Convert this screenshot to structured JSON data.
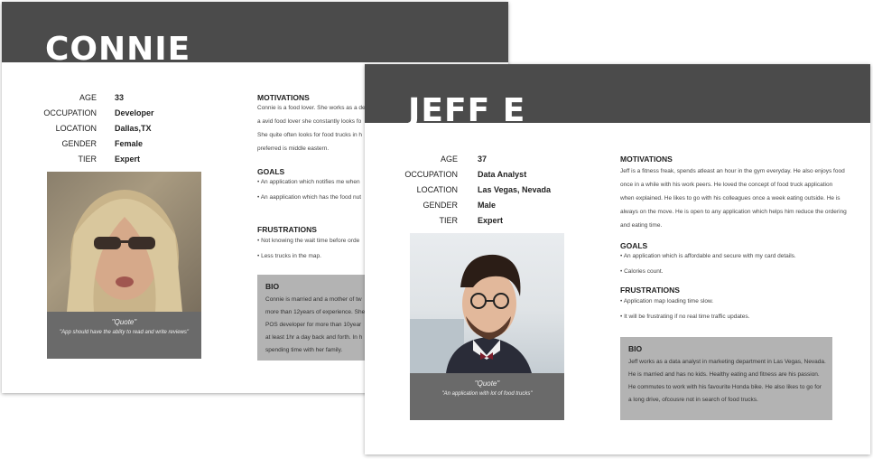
{
  "connie": {
    "name": "CONNIE",
    "facts": [
      {
        "key": "AGE",
        "value": "33"
      },
      {
        "key": "OCCUPATION",
        "value": "Developer"
      },
      {
        "key": "LOCATION",
        "value": "Dallas,TX"
      },
      {
        "key": "GENDER",
        "value": "Female"
      },
      {
        "key": "TIER",
        "value": "Expert"
      }
    ],
    "quote_title": "\"Quote\"",
    "quote_text": "\"App should have the ablity to read and write reviews\"",
    "motivations_title": "MOTIVATIONS",
    "motivations_lines": [
      "Connie  is a food lover. She works as a de",
      "a avid food lover she constantly looks  fo",
      "She quite often looks for food trucks in h",
      "preferred is middle eastern."
    ],
    "goals_title": "GOALS",
    "goals": [
      "• An application which notifies me when",
      "• An aapplication which has the food nut"
    ],
    "frustrations_title": "FRUSTRATIONS",
    "frustrations": [
      "• Not knowing the wait time before orde",
      "• Less trucks in the map."
    ],
    "bio_title": "BIO",
    "bio_lines": [
      "Connie is married and a mother of tw",
      "more than 12years of experience. She",
      "POS developer for more than 10year",
      "at least  1hr a day back and forth. In h",
      "spending time with her family."
    ],
    "colors": {
      "header": "#4b4b4b",
      "quote_bg": "#6a6a6a",
      "bio_bg": "#b3b3b3"
    }
  },
  "jeff": {
    "name": "JEFF E",
    "facts": [
      {
        "key": "AGE",
        "value": "37"
      },
      {
        "key": "OCCUPATION",
        "value": "Data Analyst"
      },
      {
        "key": "LOCATION",
        "value": "Las Vegas, Nevada"
      },
      {
        "key": "GENDER",
        "value": "Male"
      },
      {
        "key": "TIER",
        "value": "Expert"
      }
    ],
    "quote_title": "\"Quote\"",
    "quote_text": "\"An application with lot of food trucks\"",
    "motivations_title": "MOTIVATIONS",
    "motivations_lines": [
      "Jeff is a fitness freak, spends atleast an hour in the gym everyday. He also enjoys food",
      "once in a while with his work peers. He loved the concept of food truck application",
      "when explained.  He likes to go with his colleagues once a week eating outside. He is",
      "always on the move.  He is open to any application which helps him reduce the ordering",
      "and eating time."
    ],
    "goals_title": "GOALS",
    "goals": [
      "• An application which is affordable and secure with my card details.",
      "• Calories count."
    ],
    "frustrations_title": "FRUSTRATIONS",
    "frustrations": [
      "• Application map loading time slow.",
      "•  It  will be frustrating if no real time traffic updates."
    ],
    "bio_title": "BIO",
    "bio_lines": [
      "Jeff works as a data analyst in marketing department  in Las Vegas, Nevada.",
      "He is married and has no kids. Healthy eating and fitness are his passion.",
      "He commutes to work with his favourite Honda bike. He also likes to go for",
      "a long drive, ofcousre not  in search of food trucks."
    ],
    "colors": {
      "header": "#4b4b4b",
      "quote_bg": "#6a6a6a",
      "bio_bg": "#b3b3b3"
    }
  }
}
